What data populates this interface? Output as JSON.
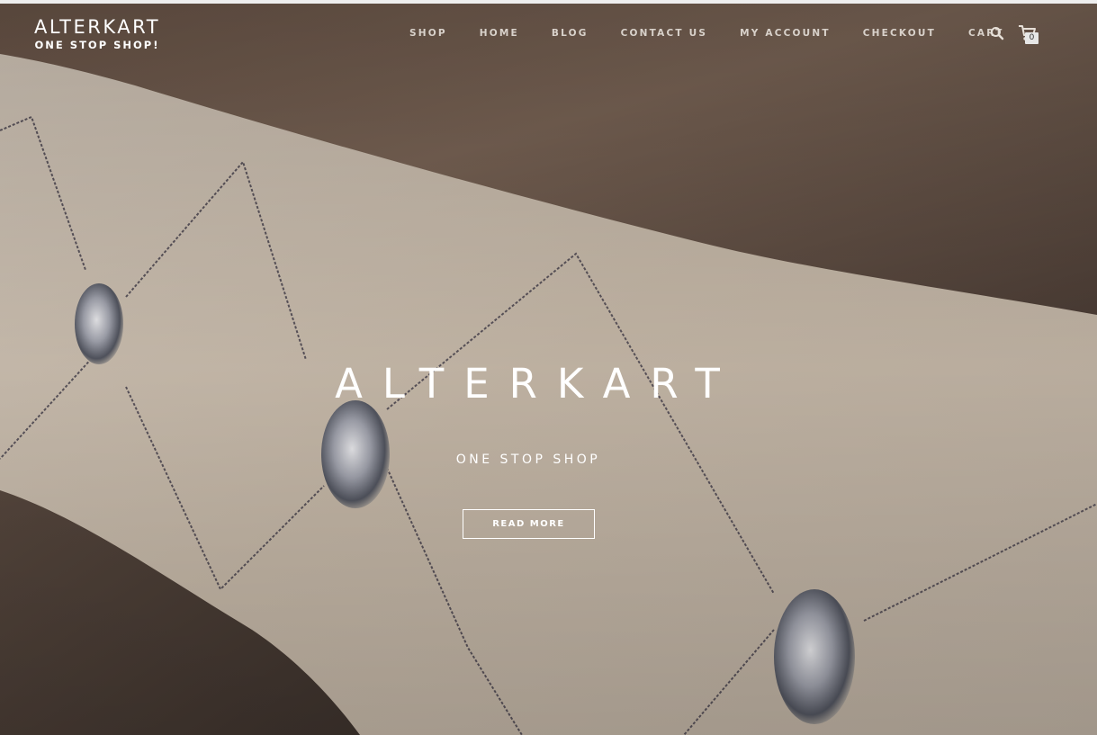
{
  "site": {
    "logo_title": "ALTERKART",
    "logo_tagline": "ONE STOP SHOP!"
  },
  "nav": {
    "items": [
      {
        "label": "SHOP"
      },
      {
        "label": "HOME"
      },
      {
        "label": "BLOG"
      },
      {
        "label": "CONTACT US"
      },
      {
        "label": "MY ACCOUNT"
      },
      {
        "label": "CHECKOUT"
      },
      {
        "label": "CART"
      }
    ],
    "search_icon": "search-icon",
    "cart_icon": "cart-icon",
    "cart_count": "0"
  },
  "hero": {
    "title": "ALTERKART",
    "subtitle": "ONE STOP SHOP",
    "button_label": "READ MORE"
  },
  "colors": {
    "text_on_hero": "#ffffff",
    "nav_text": "#d9d2cb",
    "fabric_light": "#cfc3b4",
    "fabric_dark": "#5b4b41"
  }
}
